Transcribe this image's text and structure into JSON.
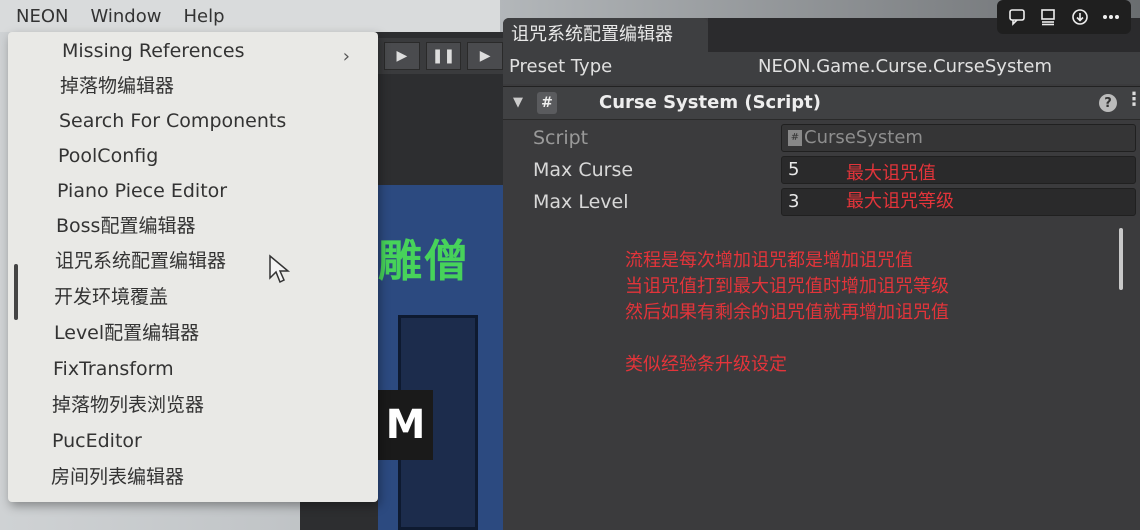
{
  "menubar": {
    "items": [
      "NEON",
      "Window",
      "Help"
    ]
  },
  "dropdown": {
    "items": [
      {
        "label": "Missing References",
        "has_submenu": true
      },
      {
        "label": "掉落物编辑器"
      },
      {
        "label": "Search For Components"
      },
      {
        "label": "PoolConfig"
      },
      {
        "label": "Piano Piece Editor"
      },
      {
        "label": "Boss配置编辑器"
      },
      {
        "label": "诅咒系统配置编辑器"
      },
      {
        "label": "开发环境覆盖"
      },
      {
        "label": "Level配置编辑器"
      },
      {
        "label": "FixTransform"
      },
      {
        "label": "掉落物列表浏览器"
      },
      {
        "label": "PucEditor"
      },
      {
        "label": "房间列表编辑器"
      }
    ],
    "submenu_arrow": "›"
  },
  "toolbar": {
    "play_icon": "▶",
    "pause_icon": "❚❚",
    "step_icon": "▶"
  },
  "game_view": {
    "text": "雕僧",
    "m_text": "M"
  },
  "inspector": {
    "tab_title": "诅咒系统配置编辑器",
    "preset_label": "Preset Type",
    "preset_value": "NEON.Game.Curse.CurseSystem",
    "component_title": "Curse System (Script)",
    "component_icon": "#",
    "help_icon": "?",
    "more_icon": "⋮",
    "properties": {
      "script": {
        "label": "Script",
        "value": "CurseSystem"
      },
      "max_curse": {
        "label": "Max Curse",
        "value": "5",
        "note": "最大诅咒值"
      },
      "max_level": {
        "label": "Max Level",
        "value": "3",
        "note": "最大诅咒等级"
      }
    },
    "annotations": [
      "流程是每次增加诅咒都是增加诅咒值",
      "当诅咒值打到最大诅咒值时增加诅咒等级",
      "然后如果有剩余的诅咒值就再增加诅咒值",
      "类似经验条升级设定"
    ]
  },
  "viewer_tools": {
    "icons": [
      "comment-icon",
      "panel-icon",
      "download-icon",
      "more-icon"
    ]
  },
  "colors": {
    "annotation": "#e3343a",
    "inspector_bg": "#3b3b3d",
    "menu_bg": "#e9e9e6"
  }
}
